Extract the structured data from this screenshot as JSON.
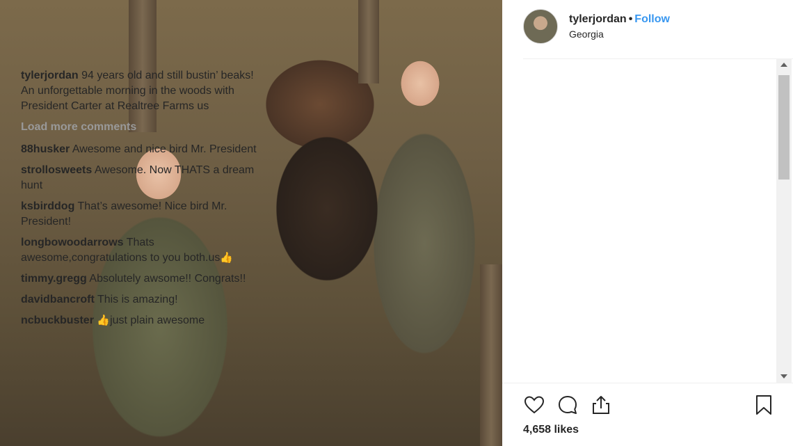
{
  "post": {
    "username": "tylerjordan",
    "separator": "•",
    "follow_label": "Follow",
    "location": "Georgia",
    "caption": {
      "username": "tylerjordan",
      "text": "94 years old and still bustin’ beaks! An unforgettable morning in the woods with President Carter at Realtree Farms us"
    },
    "load_more_label": "Load more comments",
    "comments": [
      {
        "username": "88husker",
        "text": "Awesome and nice bird Mr. President"
      },
      {
        "username": "strollosweets",
        "text": "Awesome. Now THATS a dream hunt"
      },
      {
        "username": "ksbirddog",
        "text": "That’s awesome! Nice bird Mr. President!"
      },
      {
        "username": "longbowoodarrows",
        "text": "Thats awesome,congratulations to you both.us",
        "emoji": "👍"
      },
      {
        "username": "timmy.gregg",
        "text": "Absolutely awsome!! Congrats!!"
      },
      {
        "username": "davidbancroft",
        "text": "This is amazing!"
      },
      {
        "username": "ncbuckbuster",
        "emoji": "👍",
        "text": "just plain awesome"
      }
    ],
    "likes": "4,658 likes"
  },
  "icons": {
    "like": "heart-icon",
    "comment": "comment-icon",
    "share": "share-icon",
    "save": "bookmark-icon"
  },
  "colors": {
    "follow": "#3897f0",
    "muted": "#999999",
    "text": "#262626"
  }
}
